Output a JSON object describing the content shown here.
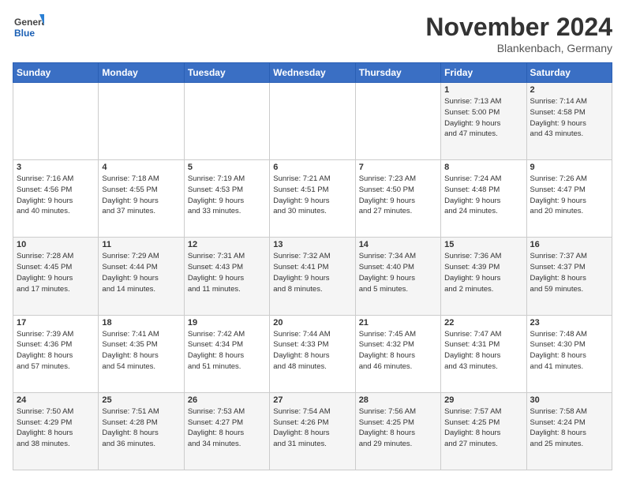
{
  "header": {
    "logo_general": "General",
    "logo_blue": "Blue",
    "month": "November 2024",
    "location": "Blankenbach, Germany"
  },
  "weekdays": [
    "Sunday",
    "Monday",
    "Tuesday",
    "Wednesday",
    "Thursday",
    "Friday",
    "Saturday"
  ],
  "weeks": [
    [
      {
        "day": "",
        "info": ""
      },
      {
        "day": "",
        "info": ""
      },
      {
        "day": "",
        "info": ""
      },
      {
        "day": "",
        "info": ""
      },
      {
        "day": "",
        "info": ""
      },
      {
        "day": "1",
        "info": "Sunrise: 7:13 AM\nSunset: 5:00 PM\nDaylight: 9 hours\nand 47 minutes."
      },
      {
        "day": "2",
        "info": "Sunrise: 7:14 AM\nSunset: 4:58 PM\nDaylight: 9 hours\nand 43 minutes."
      }
    ],
    [
      {
        "day": "3",
        "info": "Sunrise: 7:16 AM\nSunset: 4:56 PM\nDaylight: 9 hours\nand 40 minutes."
      },
      {
        "day": "4",
        "info": "Sunrise: 7:18 AM\nSunset: 4:55 PM\nDaylight: 9 hours\nand 37 minutes."
      },
      {
        "day": "5",
        "info": "Sunrise: 7:19 AM\nSunset: 4:53 PM\nDaylight: 9 hours\nand 33 minutes."
      },
      {
        "day": "6",
        "info": "Sunrise: 7:21 AM\nSunset: 4:51 PM\nDaylight: 9 hours\nand 30 minutes."
      },
      {
        "day": "7",
        "info": "Sunrise: 7:23 AM\nSunset: 4:50 PM\nDaylight: 9 hours\nand 27 minutes."
      },
      {
        "day": "8",
        "info": "Sunrise: 7:24 AM\nSunset: 4:48 PM\nDaylight: 9 hours\nand 24 minutes."
      },
      {
        "day": "9",
        "info": "Sunrise: 7:26 AM\nSunset: 4:47 PM\nDaylight: 9 hours\nand 20 minutes."
      }
    ],
    [
      {
        "day": "10",
        "info": "Sunrise: 7:28 AM\nSunset: 4:45 PM\nDaylight: 9 hours\nand 17 minutes."
      },
      {
        "day": "11",
        "info": "Sunrise: 7:29 AM\nSunset: 4:44 PM\nDaylight: 9 hours\nand 14 minutes."
      },
      {
        "day": "12",
        "info": "Sunrise: 7:31 AM\nSunset: 4:43 PM\nDaylight: 9 hours\nand 11 minutes."
      },
      {
        "day": "13",
        "info": "Sunrise: 7:32 AM\nSunset: 4:41 PM\nDaylight: 9 hours\nand 8 minutes."
      },
      {
        "day": "14",
        "info": "Sunrise: 7:34 AM\nSunset: 4:40 PM\nDaylight: 9 hours\nand 5 minutes."
      },
      {
        "day": "15",
        "info": "Sunrise: 7:36 AM\nSunset: 4:39 PM\nDaylight: 9 hours\nand 2 minutes."
      },
      {
        "day": "16",
        "info": "Sunrise: 7:37 AM\nSunset: 4:37 PM\nDaylight: 8 hours\nand 59 minutes."
      }
    ],
    [
      {
        "day": "17",
        "info": "Sunrise: 7:39 AM\nSunset: 4:36 PM\nDaylight: 8 hours\nand 57 minutes."
      },
      {
        "day": "18",
        "info": "Sunrise: 7:41 AM\nSunset: 4:35 PM\nDaylight: 8 hours\nand 54 minutes."
      },
      {
        "day": "19",
        "info": "Sunrise: 7:42 AM\nSunset: 4:34 PM\nDaylight: 8 hours\nand 51 minutes."
      },
      {
        "day": "20",
        "info": "Sunrise: 7:44 AM\nSunset: 4:33 PM\nDaylight: 8 hours\nand 48 minutes."
      },
      {
        "day": "21",
        "info": "Sunrise: 7:45 AM\nSunset: 4:32 PM\nDaylight: 8 hours\nand 46 minutes."
      },
      {
        "day": "22",
        "info": "Sunrise: 7:47 AM\nSunset: 4:31 PM\nDaylight: 8 hours\nand 43 minutes."
      },
      {
        "day": "23",
        "info": "Sunrise: 7:48 AM\nSunset: 4:30 PM\nDaylight: 8 hours\nand 41 minutes."
      }
    ],
    [
      {
        "day": "24",
        "info": "Sunrise: 7:50 AM\nSunset: 4:29 PM\nDaylight: 8 hours\nand 38 minutes."
      },
      {
        "day": "25",
        "info": "Sunrise: 7:51 AM\nSunset: 4:28 PM\nDaylight: 8 hours\nand 36 minutes."
      },
      {
        "day": "26",
        "info": "Sunrise: 7:53 AM\nSunset: 4:27 PM\nDaylight: 8 hours\nand 34 minutes."
      },
      {
        "day": "27",
        "info": "Sunrise: 7:54 AM\nSunset: 4:26 PM\nDaylight: 8 hours\nand 31 minutes."
      },
      {
        "day": "28",
        "info": "Sunrise: 7:56 AM\nSunset: 4:25 PM\nDaylight: 8 hours\nand 29 minutes."
      },
      {
        "day": "29",
        "info": "Sunrise: 7:57 AM\nSunset: 4:25 PM\nDaylight: 8 hours\nand 27 minutes."
      },
      {
        "day": "30",
        "info": "Sunrise: 7:58 AM\nSunset: 4:24 PM\nDaylight: 8 hours\nand 25 minutes."
      }
    ]
  ]
}
